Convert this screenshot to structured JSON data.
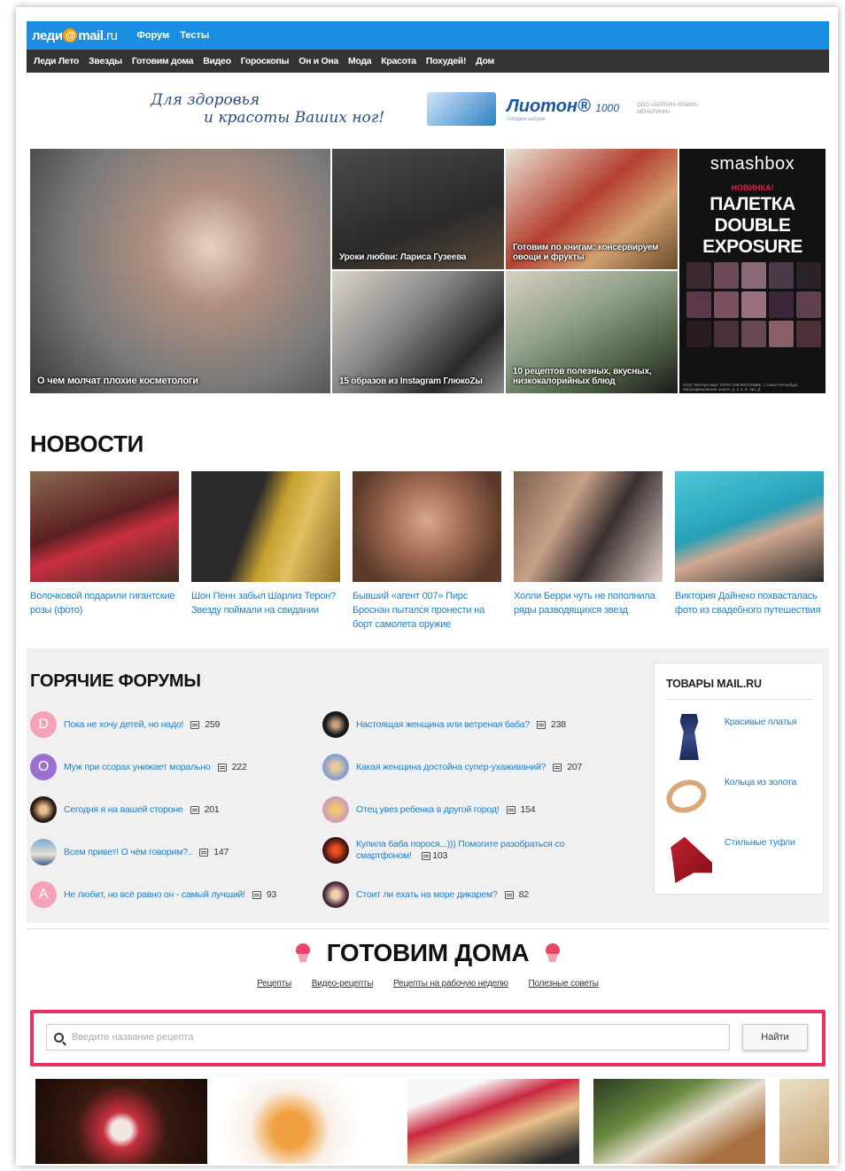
{
  "header": {
    "logo_left": "леди",
    "logo_at": "@",
    "logo_right": "mail",
    "logo_ru": ".ru",
    "links": [
      "Форум",
      "Тесты"
    ]
  },
  "nav": [
    "Леди Лето",
    "Звезды",
    "Готовим дома",
    "Видео",
    "Гороскопы",
    "Он и Она",
    "Мода",
    "Красота",
    "Похудей!",
    "Дом"
  ],
  "banner": {
    "slogan_line1": "Для здоровья",
    "slogan_line2": "и красоты Ваших ног!",
    "brand": "Лиотон",
    "brand_suffix": "1000",
    "brand_sub": "Гепарин натрия",
    "maker": "ООО «БЕРЛИН-ХЕМИ/А. МЕНАРИНИ»"
  },
  "mosaic": {
    "tiles": [
      {
        "caption": "О чем молчат плохие косметологи"
      },
      {
        "caption": "Уроки любви: Лариса Гузеева"
      },
      {
        "caption": "Готовим по книгам: консервируем овощи и фрукты"
      },
      {
        "caption": "15 образов из Instagram ГлюкоZы"
      },
      {
        "caption": "10 рецептов полезных, вкусных, низкокалорийных блюд"
      }
    ],
    "ad": {
      "brand": "smashbox",
      "new": "НОВИНКА!",
      "title": "ПАЛЕТКА DOUBLE EXPOSURE",
      "fine": "ООО \"ИнтерАлмаз\" ОГРН 1097847023666, г. Санкт-Петербург, Митрофаньевское шоссе, д. 2, к. 9, лит. Д"
    }
  },
  "news": {
    "title": "НОВОСТИ",
    "items": [
      {
        "text": "Волочковой подарили гигантские розы (фото)"
      },
      {
        "text": "Шон Пенн забыл Шарлиз Терон? Звезду поймали на свидании"
      },
      {
        "text": "Бывший «агент 007» Пирс Броснан пытался пронести на борт самолета оружие"
      },
      {
        "text": "Холли Берри чуть не пополнила ряды разводящихся звезд"
      },
      {
        "text": "Виктория Дайнеко похвасталась фото из свадебного путешествия"
      }
    ]
  },
  "forums": {
    "title": "ГОРЯЧИЕ ФОРУМЫ",
    "left": [
      {
        "avatar": "D",
        "title": "Пока не хочу детей, но надо!",
        "count": "259"
      },
      {
        "avatar": "O",
        "title": "Муж при ссорах унижает морально",
        "count": "222"
      },
      {
        "avatar": "",
        "title": "Сегодня я на вашей стороне",
        "count": "201"
      },
      {
        "avatar": "",
        "title": "Всем привет! О чём говорим?..",
        "count": "147"
      },
      {
        "avatar": "A",
        "title": "Не любит, но всё равно он - самый лучший!",
        "count": "93"
      }
    ],
    "right": [
      {
        "title": "Настоящая женщина или ветреная баба?",
        "count": "238"
      },
      {
        "title": "Какая женщина достойна супер-ухаживаний?",
        "count": "207"
      },
      {
        "title": "Отец увез ребенка в другой город!",
        "count": "154"
      },
      {
        "title": "Купила баба порося...))) Помогите разобраться со смартфоном!",
        "count": "103"
      },
      {
        "title": "Стоит ли ехать на море дикарем?",
        "count": "82"
      }
    ]
  },
  "shop": {
    "title": "ТОВАРЫ MAIL.RU",
    "items": [
      "Красивые платья",
      "Кольца из золота",
      "Стильные туфли"
    ]
  },
  "cook": {
    "title": "ГОТОВИМ ДОМА",
    "links": [
      "Рецепты",
      "Видео-рецепты",
      "Рецепты на рабочую неделю",
      "Полезные советы"
    ],
    "search_placeholder": "Введите название рецепта",
    "search_button": "Найти"
  },
  "colors": {
    "topbar": "#1a8ee0",
    "navbar": "#333333",
    "link": "#1a7fd0",
    "highlight": "#e8315f"
  }
}
